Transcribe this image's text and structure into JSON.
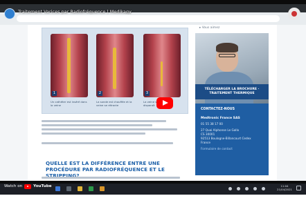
{
  "video": {
    "title": "Traitement Varices par Radiofréquence | Medikagy",
    "watch_on_label": "Watch on",
    "youtube_wordmark": "YouTube",
    "play_icon": "play-icon"
  },
  "webpage": {
    "captions": [
      "Un cathéter est inséré dans la veine",
      "La sonde est chauffée et la veine se rétracte",
      "La veine se referme et disparaît"
    ],
    "section_heading": "QUELLE EST LA DIFFÉRENCE ENTRE UNE PROCÉDURE PAR RADIOFRÉQUENCE ET LE STRIPPING?",
    "sidebar": {
      "menu_label": "▸ Vous aimez",
      "brochure_banner": "TÉLÉCHARGER LA BROCHURE · TRAITEMENT THERMIQUE",
      "contact_title": "CONTACTEZ-NOUS",
      "company": "Medtronic France SAS",
      "lines": [
        "01 55 38 17 00",
        "27 Quai Alphonse Le Gallo",
        "CS 30001",
        "92513 Boulogne-Billancourt Cedex",
        "France"
      ],
      "link": "Formulaire de contact"
    }
  },
  "taskbar": {
    "clock_time": "11:04",
    "clock_date": "21/04/2021"
  }
}
